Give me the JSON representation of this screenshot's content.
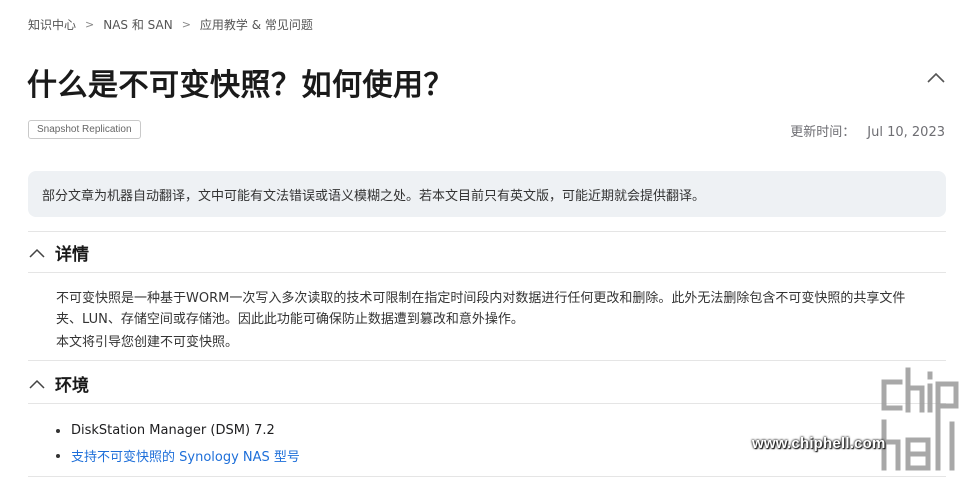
{
  "breadcrumb": {
    "items": [
      "知识中心",
      "NAS 和 SAN",
      "应用教学 & 常见问题"
    ],
    "separator": ">"
  },
  "article": {
    "title": "什么是不可变快照？如何使用？",
    "tag": "Snapshot Replication",
    "updated_label": "更新时间：",
    "updated_date": "Jul 10, 2023"
  },
  "notice": {
    "text": "部分文章为机器自动翻译，文中可能有文法错误或语义模糊之处。若本文目前只有英文版，可能近期就会提供翻译。"
  },
  "sections": {
    "details": {
      "title": "详情",
      "paragraph1_line1": "不可变快照是一种基于WORM一次写入多次读取的技术可限制在指定时间段内对数据进行任何更改和删除。此外无法删除包含不可变快照的共享文件",
      "paragraph1_line2": "夹、LUN、存储空间或存储池。因此此功能可确保防止数据遭到篡改和意外操作。",
      "paragraph2": "本文将引导您创建不可变快照。"
    },
    "environment": {
      "title": "环境",
      "items": [
        "DiskStation Manager (DSM) 7.2",
        "支持不可变快照的 Synology NAS 型号"
      ]
    }
  },
  "watermark": {
    "brand": "chiphell",
    "url": "www.chiphell.com"
  },
  "colors": {
    "link": "#1e6fd9",
    "notice_bg": "#eef1f4",
    "text": "#1d1d1f"
  }
}
